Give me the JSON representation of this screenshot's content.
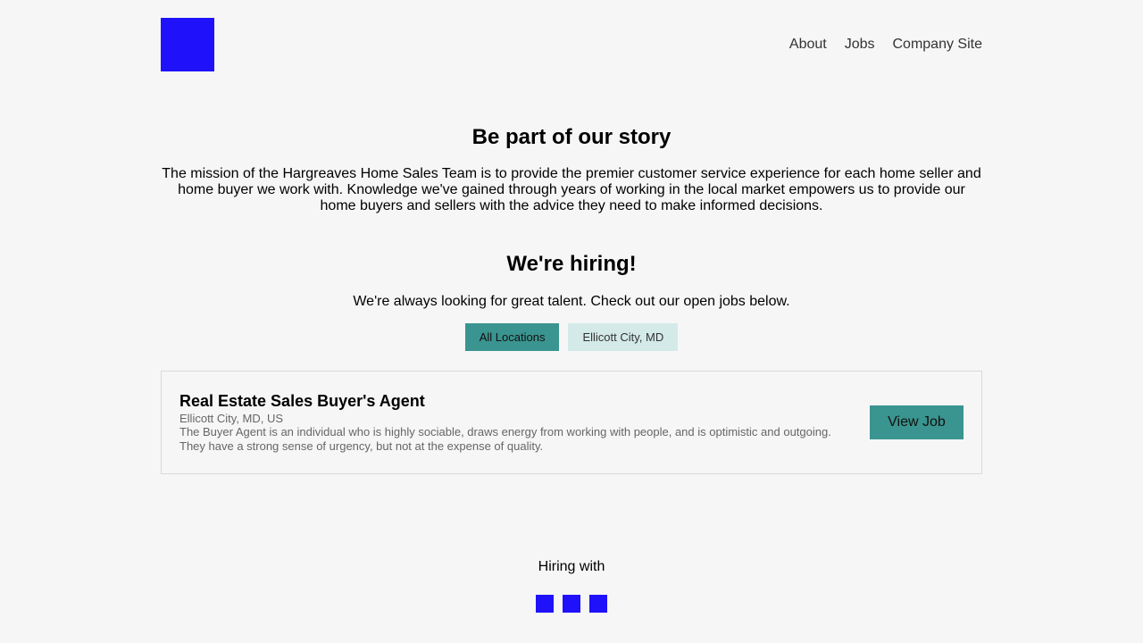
{
  "header": {
    "logo_color": "#1f12fa",
    "nav": [
      {
        "label": "About"
      },
      {
        "label": "Jobs"
      },
      {
        "label": "Company Site"
      }
    ]
  },
  "story": {
    "title": "Be part of our story",
    "body": "The mission of the Hargreaves Home Sales Team is to provide the premier customer service experience for each home seller and home buyer we work with. Knowledge we've gained through years of working in the local market empowers us to provide our home buyers and sellers with the advice they need to make informed decisions."
  },
  "hiring": {
    "title": "We're hiring!",
    "subtitle": "We're always looking for great talent. Check out our open jobs below.",
    "filters": [
      {
        "label": "All Locations",
        "active": true
      },
      {
        "label": "Ellicott City, MD",
        "active": false
      }
    ]
  },
  "jobs": [
    {
      "title": "Real Estate Sales Buyer's Agent",
      "location": "Ellicott City, MD, US",
      "description": "The Buyer Agent is an individual who is highly sociable, draws energy from working with people, and is optimistic and outgoing. They have a strong sense of urgency, but not at the expense of quality.",
      "button_label": "View Job"
    }
  ],
  "footer": {
    "label": "Hiring with",
    "social_icons": [
      "social-icon-1",
      "social-icon-2",
      "social-icon-3"
    ]
  },
  "colors": {
    "accent": "#3a948f",
    "accent_light": "#d3eae8",
    "brand": "#1f12fa",
    "background": "#f6f6f6"
  }
}
